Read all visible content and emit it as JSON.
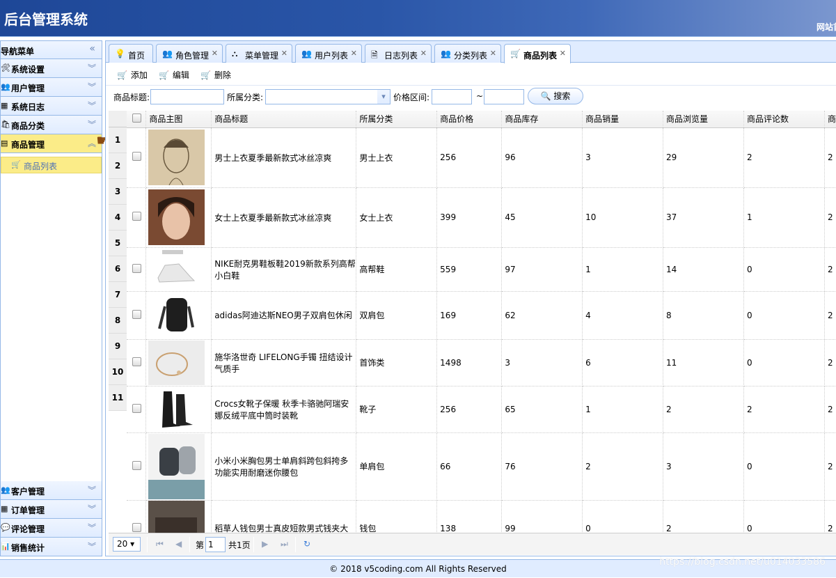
{
  "app": {
    "title": "后台管理系统",
    "header_right": "网站首页"
  },
  "sidebar": {
    "title": "导航菜单",
    "items": [
      {
        "label": "系统设置",
        "icon": "tools-icon"
      },
      {
        "label": "用户管理",
        "icon": "user-icon"
      },
      {
        "label": "系统日志",
        "icon": "log-icon"
      },
      {
        "label": "商品分类",
        "icon": "category-icon"
      },
      {
        "label": "商品管理",
        "icon": "product-icon"
      }
    ],
    "active_sub": "商品列表",
    "bottom_items": [
      {
        "label": "客户管理",
        "icon": "customer-icon"
      },
      {
        "label": "订单管理",
        "icon": "order-icon"
      },
      {
        "label": "评论管理",
        "icon": "comment-icon"
      },
      {
        "label": "销售统计",
        "icon": "stats-icon"
      }
    ]
  },
  "tabs": [
    {
      "label": "首页",
      "closable": false
    },
    {
      "label": "角色管理",
      "closable": true
    },
    {
      "label": "菜单管理",
      "closable": true
    },
    {
      "label": "用户列表",
      "closable": true
    },
    {
      "label": "日志列表",
      "closable": true
    },
    {
      "label": "分类列表",
      "closable": true
    },
    {
      "label": "商品列表",
      "closable": true,
      "selected": true
    }
  ],
  "toolbar": {
    "add": "添加",
    "edit": "编辑",
    "delete": "删除"
  },
  "search": {
    "title_label": "商品标题:",
    "category_label": "所属分类:",
    "price_label": "价格区间:",
    "tilde": "~",
    "button": "搜索"
  },
  "grid": {
    "columns": [
      "商品主图",
      "商品标题",
      "所属分类",
      "商品价格",
      "商品库存",
      "商品销量",
      "商品浏览量",
      "商品评论数",
      "商"
    ],
    "row_numbers": [
      "1",
      "2",
      "3",
      "4",
      "5",
      "6",
      "7",
      "8",
      "9",
      "10",
      "11"
    ],
    "rows": [
      {
        "title": "男士上衣夏季最新款式冰丝凉爽",
        "category": "男士上衣",
        "price": "256",
        "stock": "96",
        "sales": "3",
        "views": "29",
        "comments": "2",
        "extra": "2"
      },
      {
        "title": "女士上衣夏季最新款式冰丝凉爽",
        "category": "女士上衣",
        "price": "399",
        "stock": "45",
        "sales": "10",
        "views": "37",
        "comments": "1",
        "extra": "2"
      },
      {
        "title": "NIKE耐克男鞋板鞋2019新款系列高帮小白鞋",
        "category": "高帮鞋",
        "price": "559",
        "stock": "97",
        "sales": "1",
        "views": "14",
        "comments": "0",
        "extra": "2"
      },
      {
        "title": "adidas阿迪达斯NEO男子双肩包休闲",
        "category": "双肩包",
        "price": "169",
        "stock": "62",
        "sales": "4",
        "views": "8",
        "comments": "0",
        "extra": "2"
      },
      {
        "title": "施华洛世奇 LIFELONG手镯 扭结设计气质手",
        "category": "首饰类",
        "price": "1498",
        "stock": "3",
        "sales": "6",
        "views": "11",
        "comments": "0",
        "extra": "2"
      },
      {
        "title": "Crocs女靴子保暖 秋季卡骆驰阿瑞安娜反绒平底中筒时装靴",
        "category": "靴子",
        "price": "256",
        "stock": "65",
        "sales": "1",
        "views": "2",
        "comments": "2",
        "extra": "2"
      },
      {
        "title": "小米小米胸包男士单肩斜跨包斜挎多功能实用耐磨迷你腰包",
        "category": "单肩包",
        "price": "66",
        "stock": "76",
        "sales": "2",
        "views": "3",
        "comments": "0",
        "extra": "2"
      },
      {
        "title": "稻草人钱包男士真皮短款男式钱夹大",
        "category": "钱包",
        "price": "138",
        "stock": "99",
        "sales": "0",
        "views": "2",
        "comments": "0",
        "extra": "2"
      }
    ]
  },
  "pager": {
    "page_size": "20",
    "page_prefix": "第",
    "page_value": "1",
    "page_total": "共1页"
  },
  "footer": {
    "copyright": "© 2018 v5coding.com All Rights Reserved",
    "watermark": "https://blog.csdn.net/u014033586"
  }
}
